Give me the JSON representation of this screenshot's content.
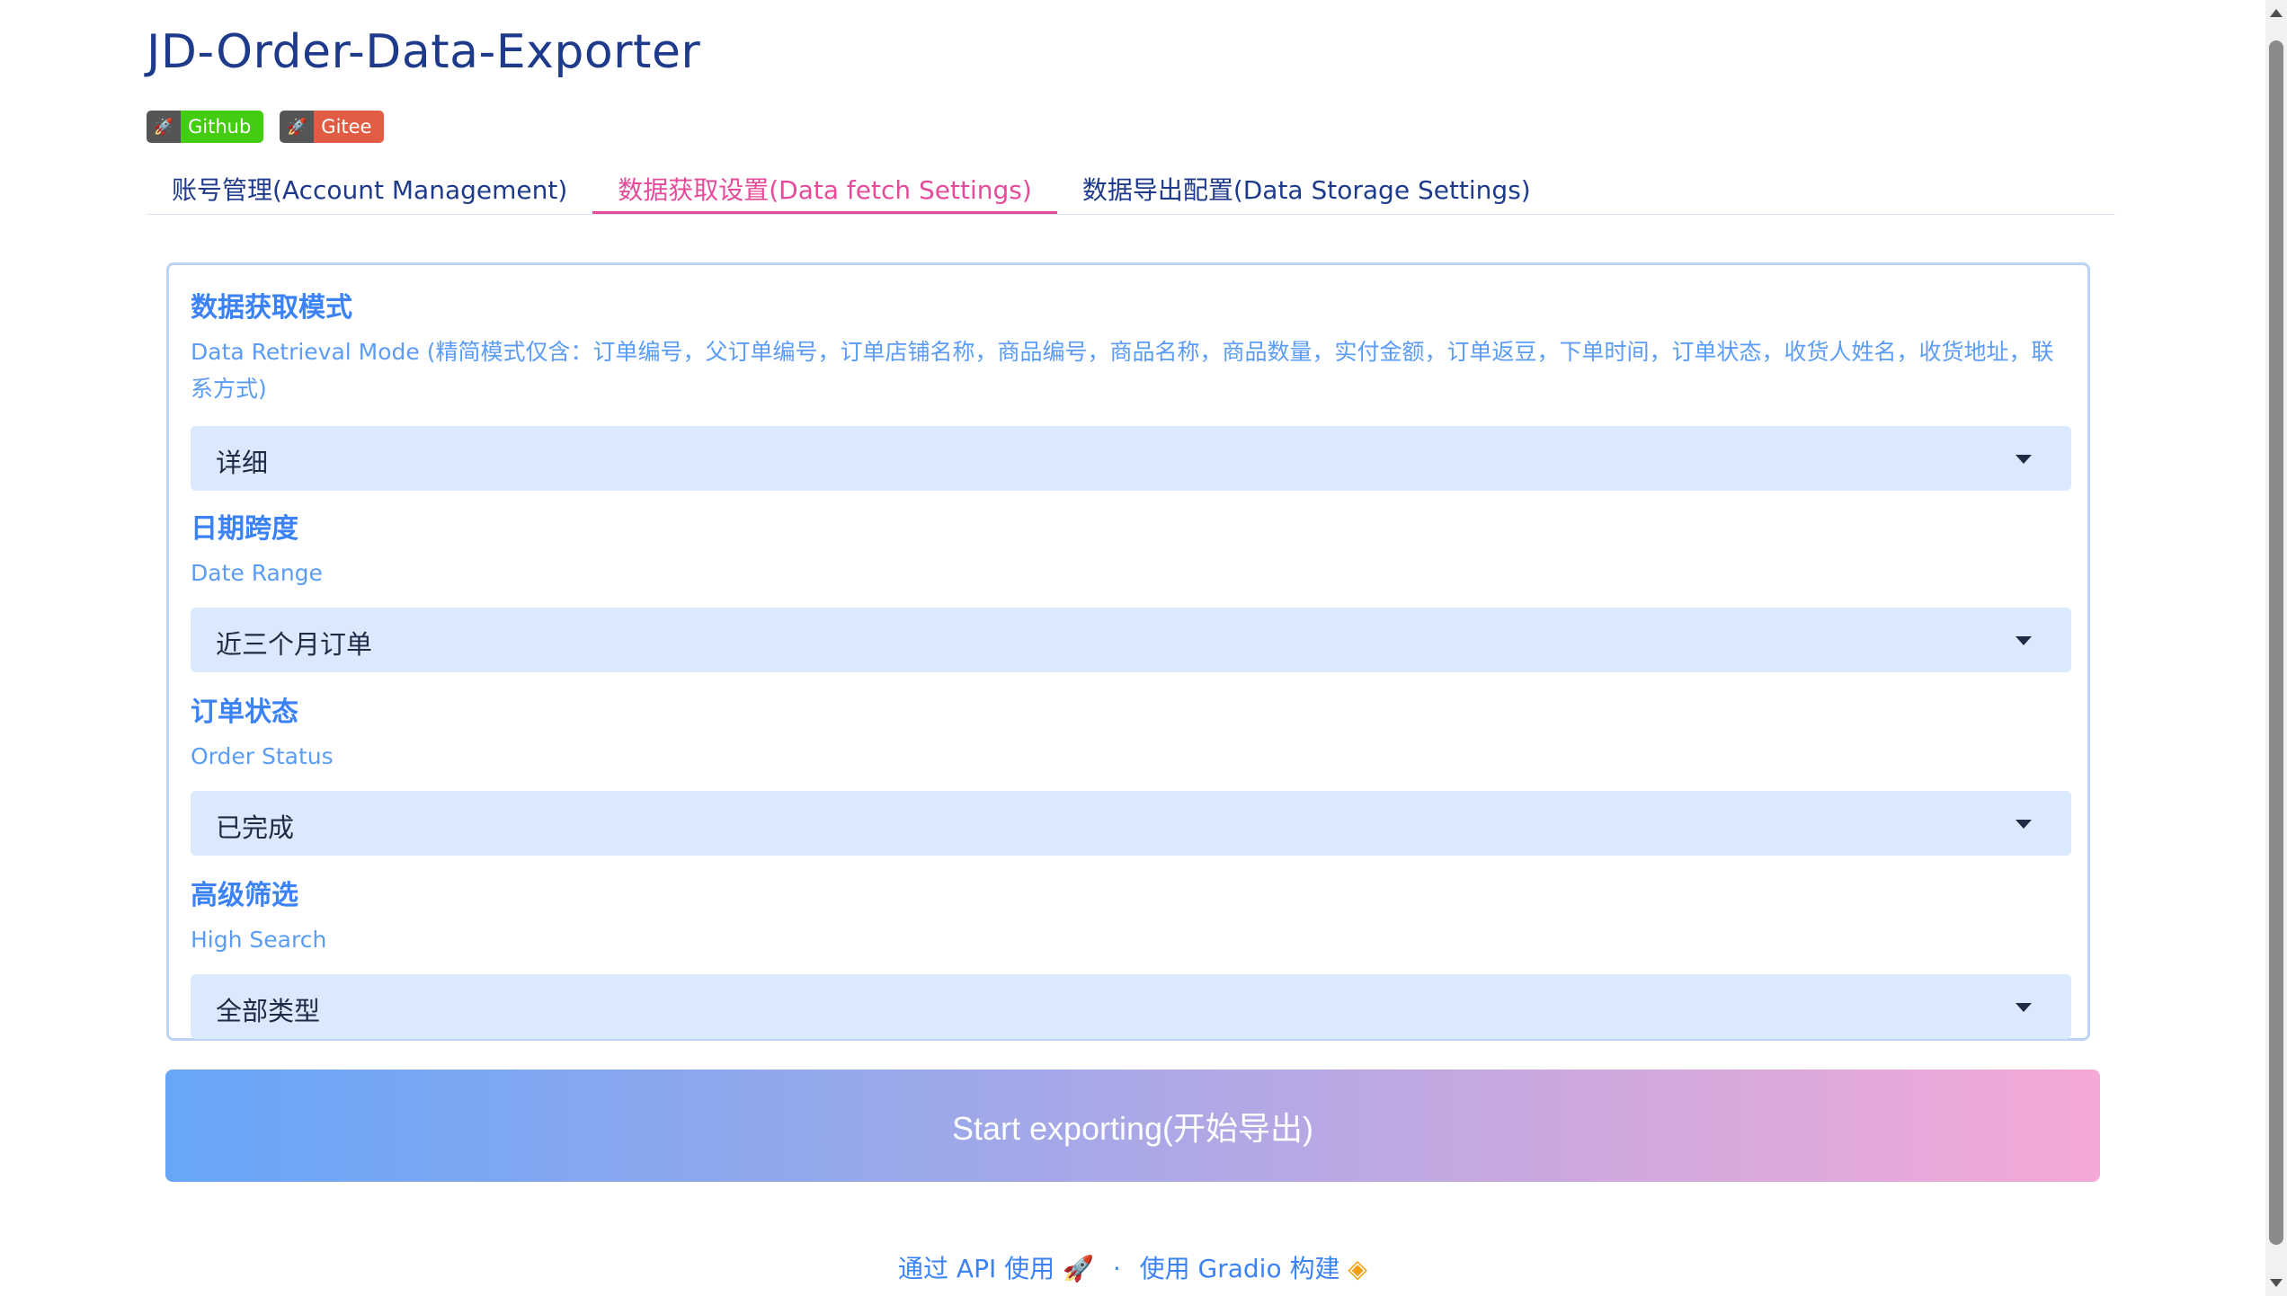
{
  "app": {
    "title": "JD-Order-Data-Exporter"
  },
  "badges": [
    {
      "icon": "rocket-icon",
      "label": "Github",
      "color": "#44cc11"
    },
    {
      "icon": "rocket-icon",
      "label": "Gitee",
      "color": "#e05d44"
    }
  ],
  "tabs": [
    {
      "label": "账号管理(Account Management)",
      "active": false
    },
    {
      "label": "数据获取设置(Data fetch Settings)",
      "active": true
    },
    {
      "label": "数据导出配置(Data Storage Settings)",
      "active": false
    }
  ],
  "fields": [
    {
      "label": "数据获取模式",
      "info": "Data Retrieval Mode (精简模式仅含：订单编号，父订单编号，订单店铺名称，商品编号，商品名称，商品数量，实付金额，订单返豆，下单时间，订单状态，收货人姓名，收货地址，联系方式)",
      "value": "详细"
    },
    {
      "label": "日期跨度",
      "info": "Date Range",
      "value": "近三个月订单"
    },
    {
      "label": "订单状态",
      "info": "Order Status",
      "value": "已完成"
    },
    {
      "label": "高级筛选",
      "info": "High Search",
      "value": "全部类型"
    }
  ],
  "start_button": {
    "label": "Start exporting(开始导出)"
  },
  "footer": {
    "api_link": "通过 API 使用",
    "separator": "·",
    "built_with": "使用 Gradio 构建"
  },
  "colors": {
    "accent": "#3b82f6",
    "active_tab": "#e64a9a",
    "title": "#1e3a8a",
    "select_bg": "#dbe9fe"
  }
}
